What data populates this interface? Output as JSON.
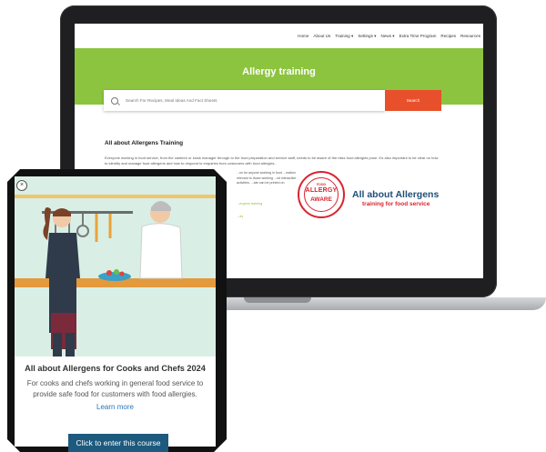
{
  "website": {
    "nav": [
      "Home",
      "About Us",
      "Training ▾",
      "Settings ▾",
      "News ▾",
      "Extra Time Program",
      "Recipes",
      "Resources"
    ],
    "hero_title": "Allergy training",
    "search": {
      "placeholder": "Search For Recipes, Meal Ideas And Fact Sheets",
      "button": "Search"
    },
    "section_title": "All about Allergens Training",
    "body_text": "Everyone working in food service, from the canteen or kiosk manager through to the food preparation and service staff, needs to be aware of the risks food allergies pose. It's also important to be clear on how to identify and manage food allergens and how to respond to enquiries from customers with food allergies.",
    "body_text_2": "...ns for anyone working in food ...mation relevant to those working ...nd interactive activities. ...ate can be printed on",
    "link_1": "...ergens training",
    "link_2": "...ds",
    "logo": {
      "line1": "FOOD",
      "line2": "ALLERGY",
      "line3": "AWARE"
    },
    "brand_title": "All about Allergens",
    "brand_subtitle": "training for food service"
  },
  "card": {
    "close_icon": "×",
    "title": "All about Allergens for Cooks and Chefs 2024",
    "description": "For cooks and chefs working in general food service to provide safe food for customers with food allergies.",
    "learn_more": "Learn more",
    "button": "Click to enter this course"
  },
  "colors": {
    "hero": "#8cc43f",
    "search_button": "#e8502b",
    "brand_blue": "#1e4e79",
    "brand_red": "#d8242f",
    "course_button": "#1d5a7e"
  }
}
